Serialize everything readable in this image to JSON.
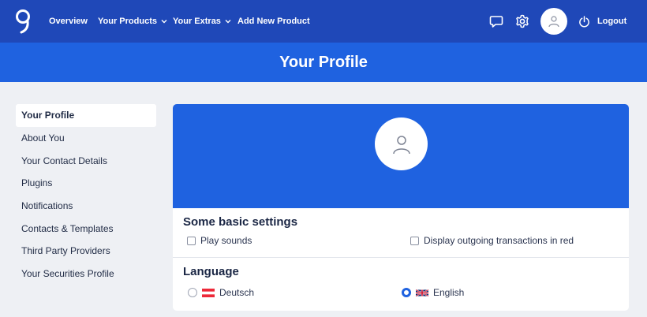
{
  "nav": {
    "overview": "Overview",
    "your_products": "Your Products",
    "your_extras": "Your Extras",
    "add_new_product": "Add New Product",
    "logout": "Logout"
  },
  "banner": {
    "title": "Your Profile"
  },
  "sidebar": {
    "items": [
      {
        "label": "Your Profile",
        "active": true
      },
      {
        "label": "About You"
      },
      {
        "label": "Your Contact Details"
      },
      {
        "label": "Plugins"
      },
      {
        "label": "Notifications"
      },
      {
        "label": "Contacts & Templates"
      },
      {
        "label": "Third Party Providers"
      },
      {
        "label": "Your Securities Profile"
      }
    ]
  },
  "settings": {
    "title": "Some basic settings",
    "play_sounds": {
      "label": "Play sounds",
      "checked": false
    },
    "outgoing_red": {
      "label": "Display outgoing transactions in red",
      "checked": false
    }
  },
  "language": {
    "title": "Language",
    "options": [
      {
        "label": "Deutsch",
        "flag": "austria-flag",
        "selected": false
      },
      {
        "label": "English",
        "flag": "uk-flag",
        "selected": true
      }
    ]
  },
  "colors": {
    "nav_bg": "#1f48b8",
    "banner_bg": "#1f62e0",
    "page_bg": "#eef0f4"
  }
}
